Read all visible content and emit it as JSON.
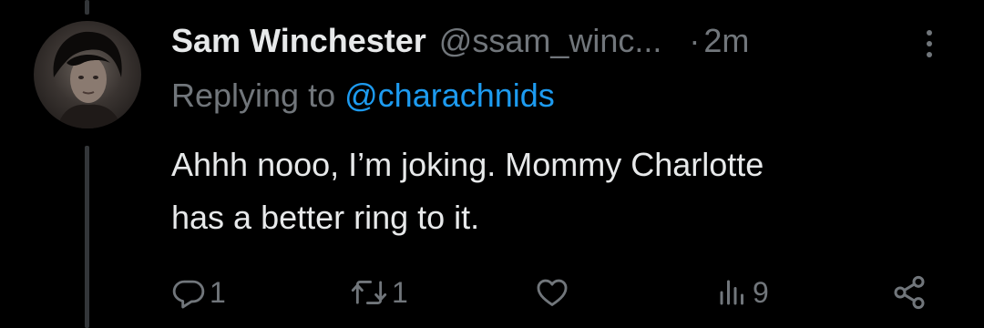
{
  "tweet": {
    "display_name": "Sam Winchester",
    "handle": "@ssam_winc...",
    "separator": "·",
    "time": "2m",
    "replying_prefix": "Replying to",
    "replying_to": "@charachnids",
    "text_lines": [
      "Ahhh nooo, I’m joking. Mommy Charlotte",
      "has a better ring to it."
    ]
  },
  "actions": {
    "reply_count": "1",
    "retweet_count": "1",
    "like_count": "",
    "views_count": "9"
  },
  "icons": {
    "more": "more-vertical-icon",
    "reply": "reply-bubble-icon",
    "retweet": "retweet-icon",
    "like": "heart-icon",
    "views": "views-bar-chart-icon",
    "share": "share-icon"
  },
  "colors": {
    "background": "#000000",
    "text_primary": "#e7e9ea",
    "text_secondary": "#71767b",
    "accent": "#1d9bf0",
    "thread_line": "#333639"
  }
}
